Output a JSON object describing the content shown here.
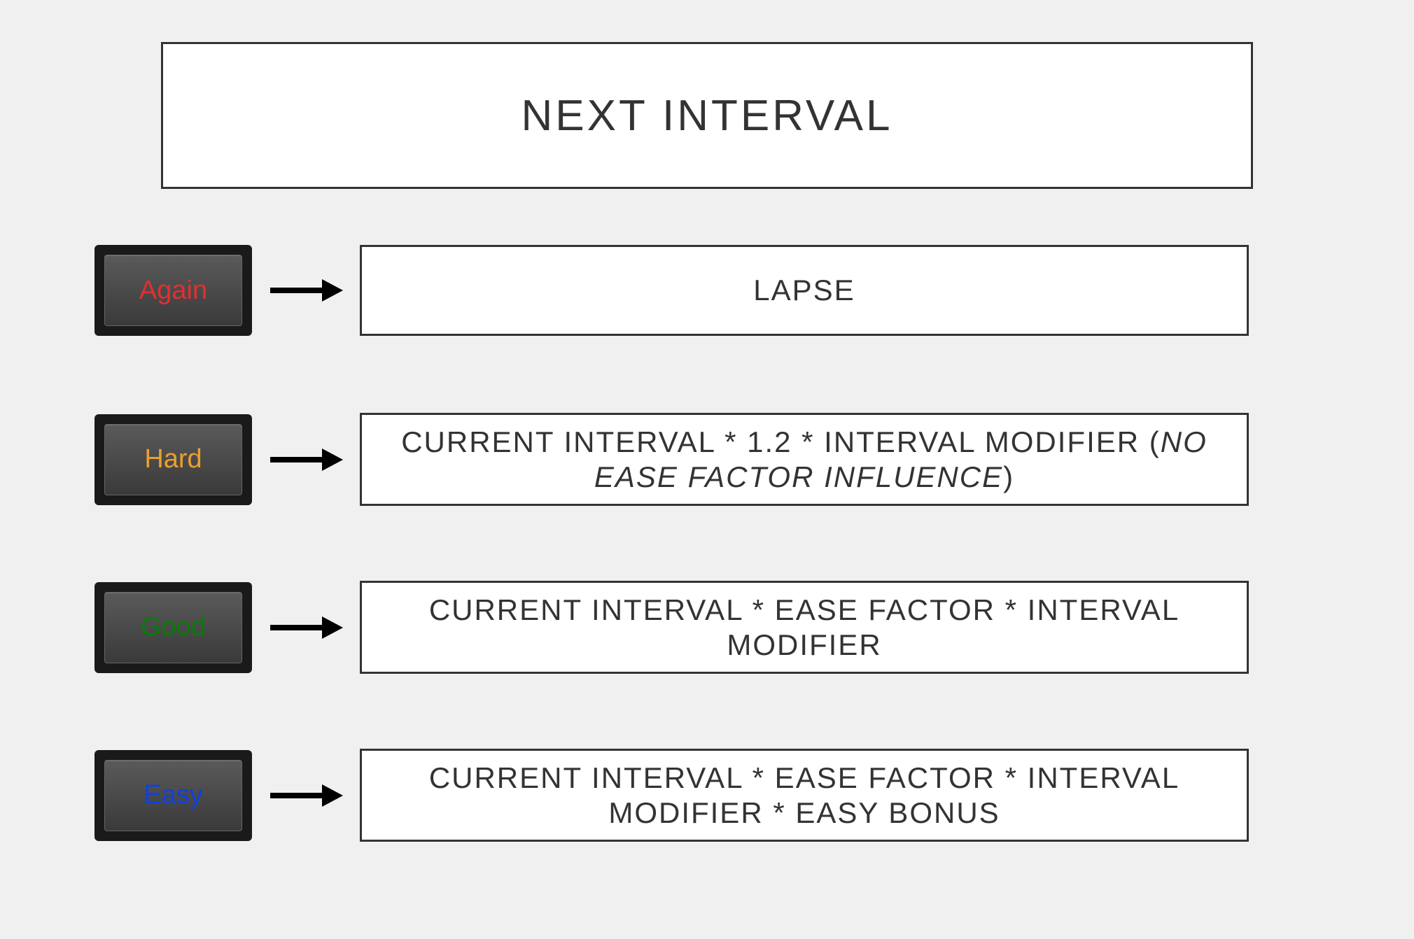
{
  "header": {
    "title": "NEXT INTERVAL"
  },
  "rows": [
    {
      "button_label": "Again",
      "formula": "LAPSE"
    },
    {
      "button_label": "Hard",
      "formula_html": "CURRENT INTERVAL * 1.2 * INTERVAL MODIFIER (<em>NO EASE FACTOR INFLUENCE</em>)"
    },
    {
      "button_label": "Good",
      "formula": "CURRENT INTERVAL * EASE FACTOR * INTERVAL MODIFIER"
    },
    {
      "button_label": "Easy",
      "formula": "CURRENT INTERVAL * EASE FACTOR * INTERVAL MODIFIER * EASY BONUS"
    }
  ],
  "colors": {
    "again": "#e03030",
    "hard": "#e8a030",
    "good": "#0a7a0a",
    "easy": "#1040e0"
  }
}
